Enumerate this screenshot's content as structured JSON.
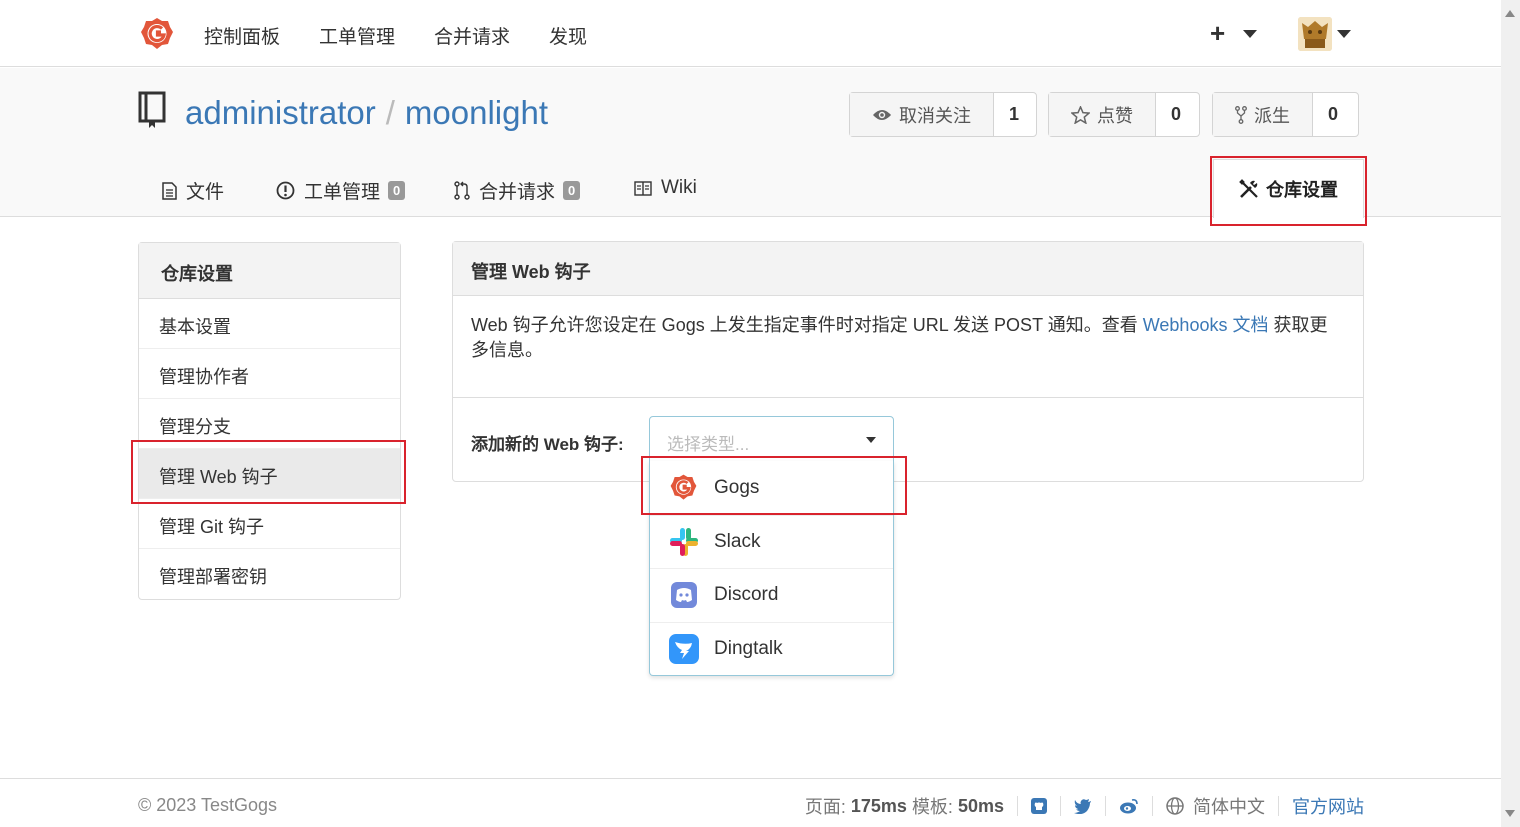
{
  "nav": {
    "items": [
      "控制面板",
      "工单管理",
      "合并请求",
      "发现"
    ],
    "plus_icon": "plus-icon"
  },
  "repo": {
    "owner": "administrator",
    "separator": "/",
    "name": "moonlight",
    "watch": {
      "label": "取消关注",
      "count": "1"
    },
    "star": {
      "label": "点赞",
      "count": "0"
    },
    "fork": {
      "label": "派生",
      "count": "0"
    }
  },
  "tabs": {
    "files": "文件",
    "issues": {
      "label": "工单管理",
      "badge": "0"
    },
    "pulls": {
      "label": "合并请求",
      "badge": "0"
    },
    "wiki": "Wiki",
    "settings": "仓库设置"
  },
  "sidebar": {
    "title": "仓库设置",
    "items": [
      {
        "label": "基本设置"
      },
      {
        "label": "管理协作者"
      },
      {
        "label": "管理分支"
      },
      {
        "label": "管理 Web 钩子"
      },
      {
        "label": "管理 Git 钩子"
      },
      {
        "label": "管理部署密钥"
      }
    ]
  },
  "panel": {
    "title": "管理 Web 钩子",
    "desc_before": "Web 钩子允许您设定在 Gogs 上发生指定事件时对指定 URL 发送 POST 通知。查看 ",
    "desc_link": "Webhooks 文档",
    "desc_after": " 获取更多信息。",
    "add_label": "添加新的 Web 钩子:",
    "select_placeholder": "选择类型..."
  },
  "webhook_types": [
    {
      "label": "Gogs",
      "icon": "gogs-icon"
    },
    {
      "label": "Slack",
      "icon": "slack-icon"
    },
    {
      "label": "Discord",
      "icon": "discord-icon"
    },
    {
      "label": "Dingtalk",
      "icon": "dingtalk-icon"
    }
  ],
  "footer": {
    "copyright": "© 2023 TestGogs",
    "page_label": "页面:",
    "page_time": "175ms",
    "tpl_label": "模板:",
    "tpl_time": "50ms",
    "language": "简体中文",
    "website": "官方网站"
  },
  "colors": {
    "link": "#3b78b5",
    "highlight": "#d9232d",
    "gogs": "#f05133"
  }
}
